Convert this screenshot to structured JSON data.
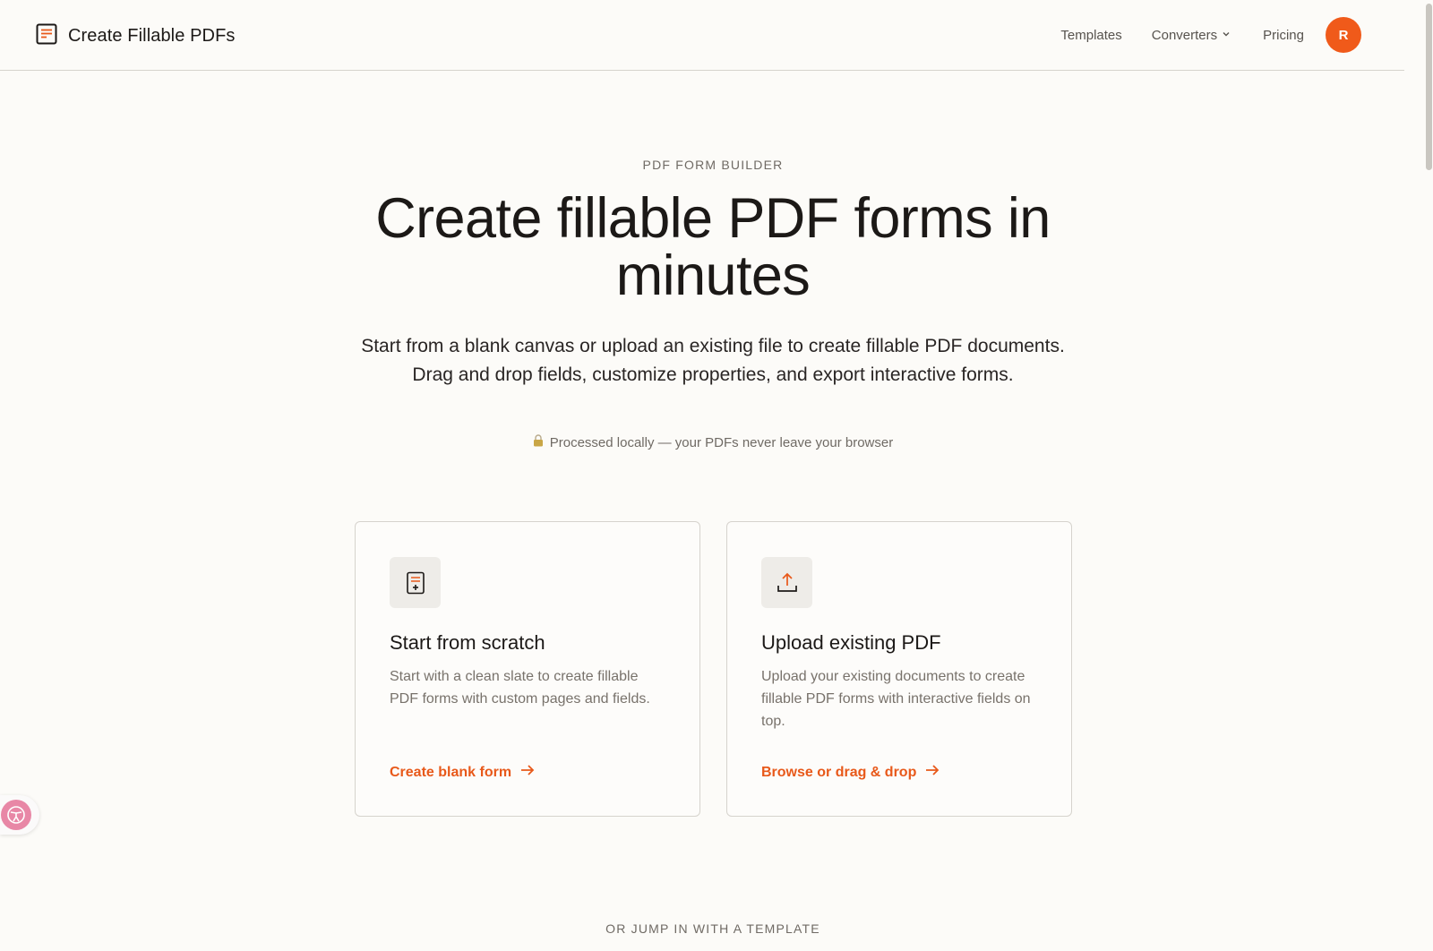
{
  "header": {
    "brand_title": "Create Fillable PDFs",
    "nav": {
      "templates": "Templates",
      "converters": "Converters",
      "pricing": "Pricing"
    },
    "avatar_initial": "R"
  },
  "hero": {
    "eyebrow": "PDF FORM BUILDER",
    "headline": "Create fillable PDF forms in minutes",
    "subhead": "Start from a blank canvas or upload an existing file to create fillable PDF documents. Drag and drop fields, customize properties, and export interactive forms.",
    "privacy_note": "Processed locally — your PDFs never leave your browser"
  },
  "cards": {
    "scratch": {
      "icon": "blank-form-icon",
      "title": "Start from scratch",
      "description": "Start with a clean slate to create fillable PDF forms with custom pages and fields.",
      "cta": "Create blank form"
    },
    "upload": {
      "icon": "upload-icon",
      "title": "Upload existing PDF",
      "description": "Upload your existing documents to create fillable PDF forms with interactive fields on top.",
      "cta": "Browse or drag & drop"
    }
  },
  "templates_section": {
    "heading": "OR JUMP IN WITH A TEMPLATE"
  },
  "colors": {
    "accent": "#e8591a",
    "avatar": "#f05a1a",
    "background": "#fcfbf8",
    "border": "#d6d3cd"
  }
}
